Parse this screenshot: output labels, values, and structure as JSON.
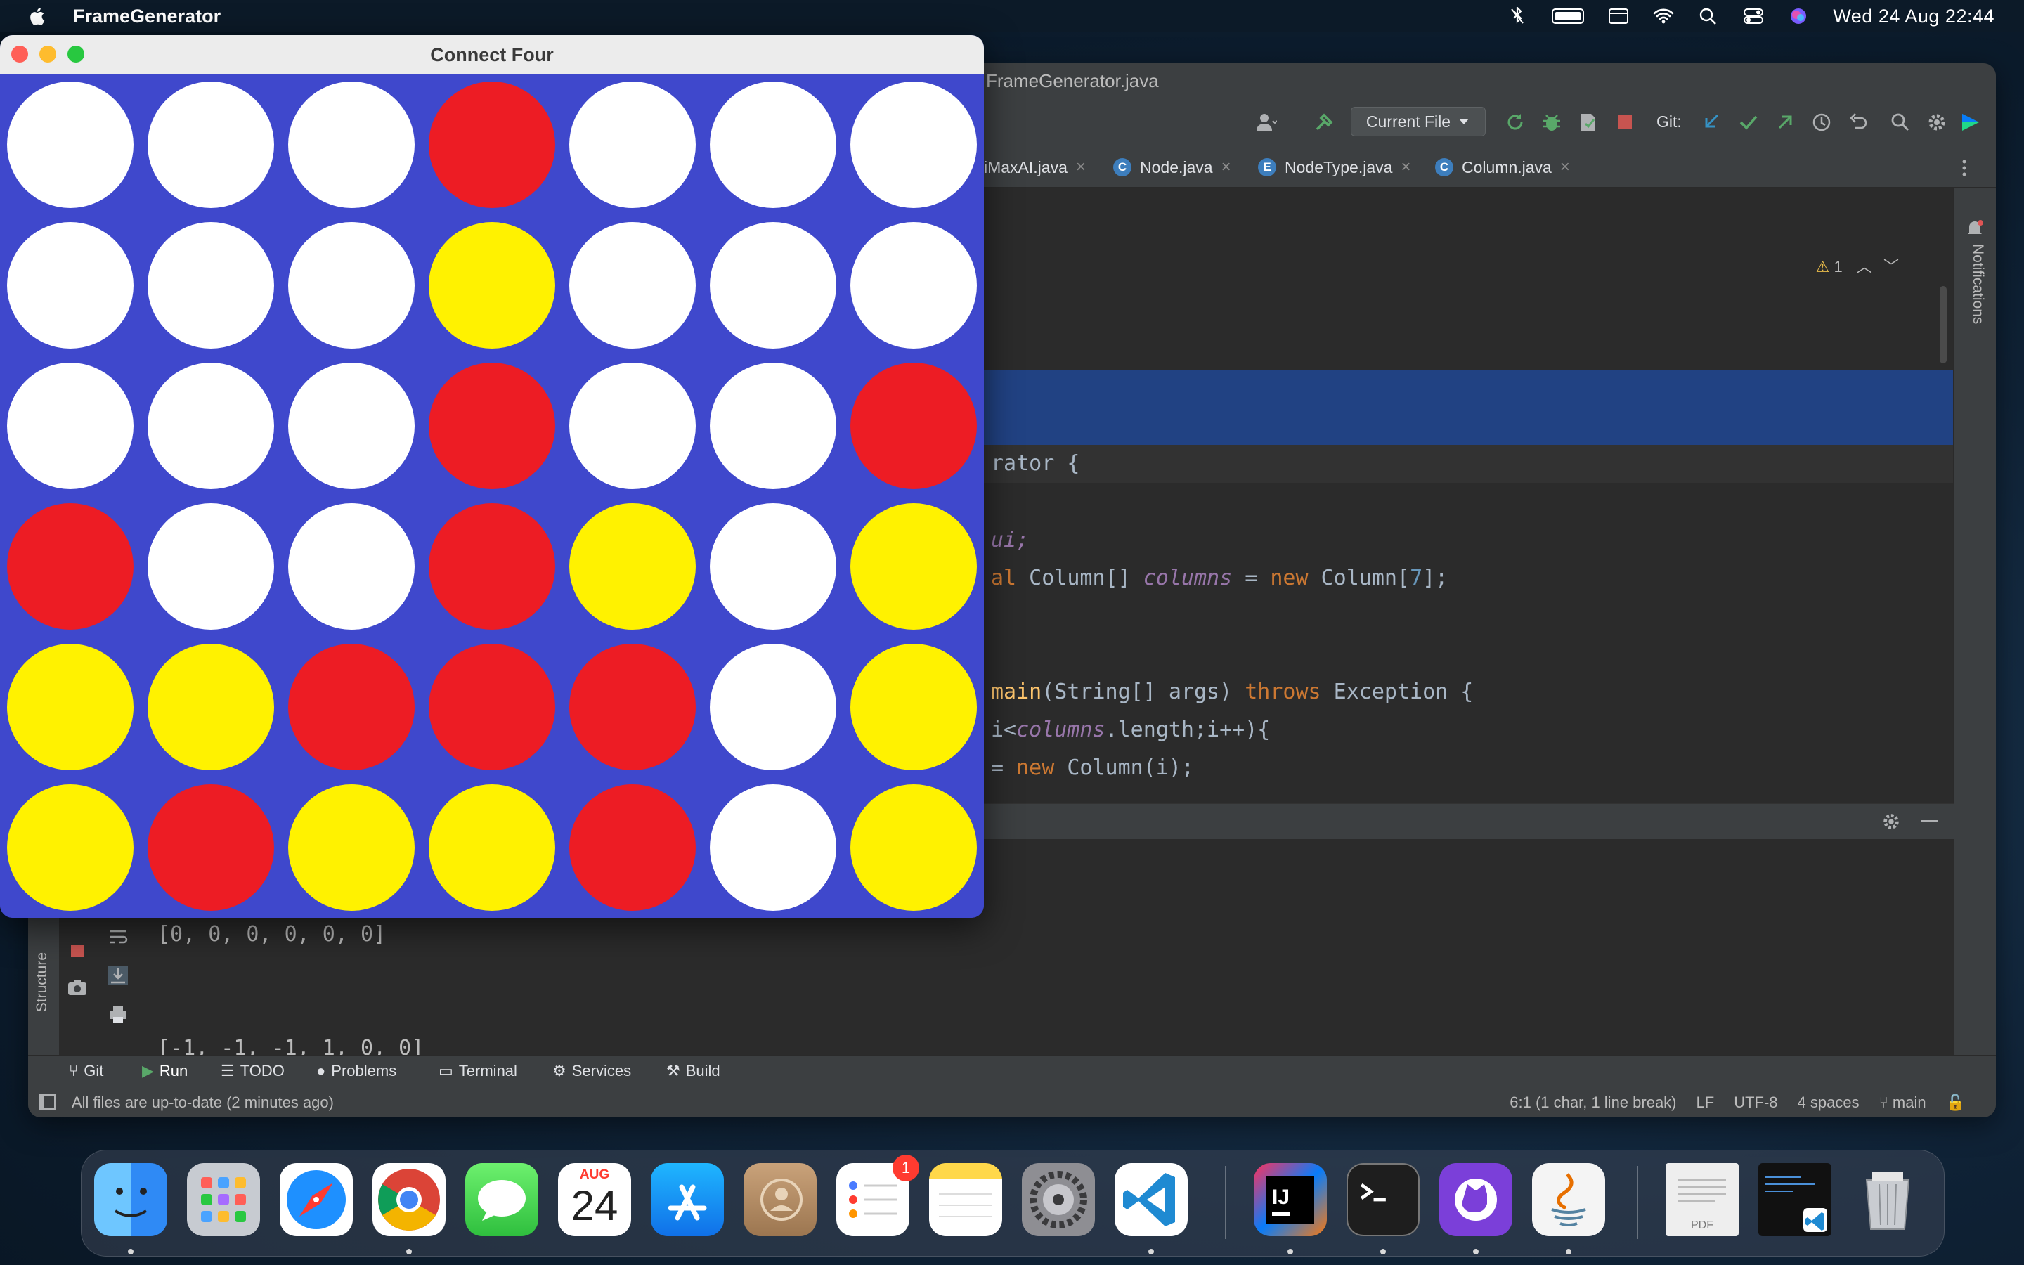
{
  "menubar": {
    "app_name": "FrameGenerator",
    "date_time": "Wed 24 Aug  22:44"
  },
  "ide": {
    "title": "FrameGenerator.java",
    "run_config": "Current File",
    "git_label": "Git:",
    "tabs": [
      {
        "label": "iMaxAI.java",
        "icon": "class-icon"
      },
      {
        "label": "Node.java",
        "icon": "class-icon"
      },
      {
        "label": "NodeType.java",
        "icon": "enum-icon"
      },
      {
        "label": "Column.java",
        "icon": "class-icon"
      }
    ],
    "warning_count": "1",
    "notifications_label": "Notifications",
    "structure_label": "Structure",
    "code_lines": [
      "rator {",
      "ui;",
      "al Column[] columns = new Column[7];",
      "main(String[] args) throws Exception {",
      "i<columns.length;i++){",
      "= new Column(i);"
    ],
    "console_lines": [
      "[0, 0, 0, 0, 0, 0]",
      "[-1, -1, -1, 1, 0, 0]",
      "-----------------------------------------------"
    ],
    "bottom_tabs": [
      "Git",
      "Run",
      "TODO",
      "Problems",
      "Terminal",
      "Services",
      "Build"
    ],
    "status_left": "All files are up-to-date (2 minutes ago)",
    "status_right": [
      "6:1 (1 char, 1 line break)",
      "LF",
      "UTF-8",
      "4 spaces",
      "main"
    ]
  },
  "connect_four": {
    "title": "Connect Four",
    "colors": {
      "board": "#3f48cc",
      "empty": "#ffffff",
      "red": "#ed1c24",
      "yellow": "#fff200"
    },
    "grid": [
      [
        "W",
        "W",
        "W",
        "R",
        "W",
        "W",
        "W"
      ],
      [
        "W",
        "W",
        "W",
        "Y",
        "W",
        "W",
        "W"
      ],
      [
        "W",
        "W",
        "W",
        "R",
        "W",
        "W",
        "R"
      ],
      [
        "R",
        "W",
        "W",
        "R",
        "Y",
        "W",
        "Y"
      ],
      [
        "Y",
        "Y",
        "R",
        "R",
        "R",
        "W",
        "Y"
      ],
      [
        "Y",
        "R",
        "Y",
        "Y",
        "R",
        "W",
        "Y"
      ]
    ]
  },
  "dock": {
    "apps": [
      "Finder",
      "Launchpad",
      "Safari",
      "Chrome",
      "Messages",
      "Calendar",
      "App Store",
      "Contacts",
      "Reminders",
      "Notes",
      "System Preferences",
      "Visual Studio Code",
      "IntelliJ IDEA",
      "Terminal",
      "GitHub Desktop",
      "Java"
    ],
    "calendar_month": "AUG",
    "calendar_day": "24",
    "reminders_badge": "1",
    "pdf_label": "PDF"
  }
}
